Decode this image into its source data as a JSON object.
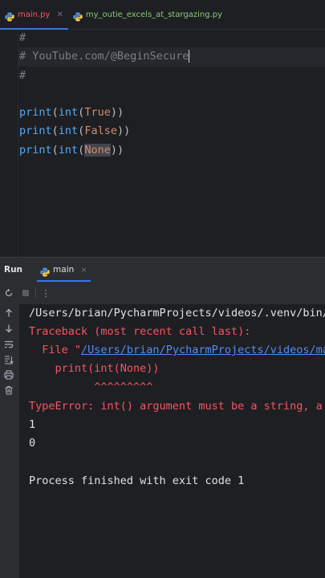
{
  "tabs": [
    {
      "label": "main.py",
      "active": true,
      "color": "#f75464"
    },
    {
      "label": "my_outie_excels_at_stargazing.py",
      "active": false,
      "color": "#89ca78"
    }
  ],
  "editor": {
    "lines": [
      {
        "id": "c1",
        "text": "#"
      },
      {
        "id": "c2",
        "text": "# YouTube.com/@BeginSecure"
      },
      {
        "id": "c3",
        "text": "#"
      },
      {
        "id": "blank",
        "text": ""
      },
      {
        "id": "p1",
        "fn": "print",
        "inner_fn": "int",
        "arg": "True"
      },
      {
        "id": "p2",
        "fn": "print",
        "inner_fn": "int",
        "arg": "False"
      },
      {
        "id": "p3",
        "fn": "print",
        "inner_fn": "int",
        "arg": "None"
      }
    ],
    "open_paren": "(",
    "close_parens": "))"
  },
  "run_panel": {
    "title": "Run",
    "config_tab": "main",
    "close_glyph": "×",
    "more_glyph": "⋮"
  },
  "console": {
    "command": "/Users/brian/PycharmProjects/videos/.venv/bin/",
    "traceback_header": "Traceback (most recent call last):",
    "file_prefix": "  File \"",
    "file_link": "/Users/brian/PycharmProjects/videos/ma",
    "code_line": "    print(int(None))",
    "caret_line": "          ^^^^^^^^^",
    "error": "TypeError: int() argument must be a string, a",
    "output_1": "1",
    "output_2": "0",
    "exit_message": "Process finished with exit code 1"
  },
  "icons": {
    "rerun": "rerun-icon",
    "stop": "stop-icon",
    "up": "arrow-up-icon",
    "down": "arrow-down-icon",
    "wrap": "soft-wrap-icon",
    "scroll_end": "scroll-to-end-icon",
    "print": "print-icon",
    "trash": "trash-icon"
  },
  "colors": {
    "background": "#1e1f22",
    "panel": "#2b2d30",
    "error": "#f75464",
    "link": "#548af7",
    "keyword": "#cf8e6d",
    "function": "#56a8f5",
    "comment": "#7a7e85",
    "accent": "#3574f0"
  }
}
